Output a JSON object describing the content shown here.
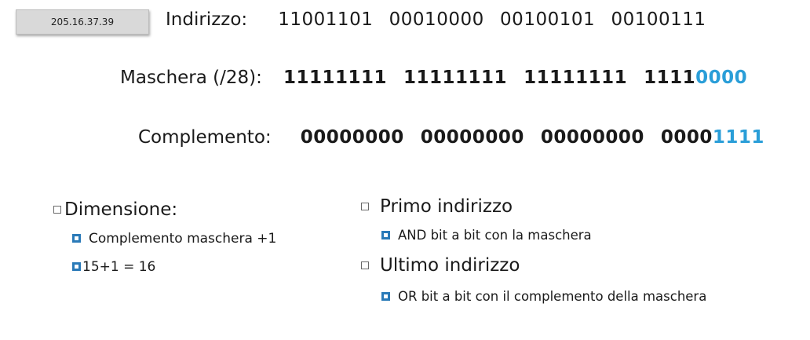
{
  "badge": {
    "ip": "205.16.37.39"
  },
  "address": {
    "label": "Indirizzo:",
    "octets": [
      "11001101",
      "00010000",
      "00100101",
      "00100111"
    ]
  },
  "mask": {
    "label": "Maschera (/28):",
    "octets": [
      "11111111",
      "11111111",
      "11111111"
    ],
    "last_plain": "1111",
    "last_highlight": "0000"
  },
  "complement": {
    "label": "Complemento:",
    "octets": [
      "00000000",
      "00000000",
      "00000000"
    ],
    "last_plain": "0000",
    "last_highlight": "1111"
  },
  "left": {
    "heading": "Dimensione:",
    "items": [
      "Complemento maschera +1",
      "15+1 = 16"
    ]
  },
  "right": {
    "first_heading": "Primo indirizzo",
    "first_item": "AND bit a bit con la maschera",
    "last_heading": "Ultimo indirizzo",
    "last_item": "OR bit a bit con il complemento della maschera"
  },
  "colors": {
    "highlight": "#2a9ed8",
    "bullet": "#2a7ab8"
  }
}
